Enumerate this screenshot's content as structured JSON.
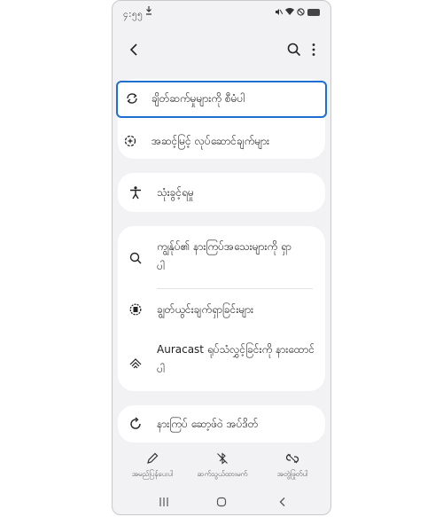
{
  "status_bar": {
    "time": "၄:၅၅",
    "icons": [
      "download-icon",
      "mute-icon",
      "wifi-icon",
      "block-icon",
      "battery-icon"
    ]
  },
  "app_bar": {
    "icons": [
      "back-icon",
      "search-icon",
      "more-options-icon"
    ]
  },
  "menu": {
    "highlighted": "ချိတ်ဆက်မှုများကို စီမံပါ",
    "group1": [
      {
        "label": "အဆင့်မြင့် လုပ်ဆောင်ချက်များ",
        "icon": "gear-plus-icon"
      }
    ],
    "group2": [
      {
        "label": "သုံးခွင့်ရမှု",
        "icon": "accessibility-icon"
      }
    ],
    "group3": [
      {
        "label": "ကျွန်ုပ်၏ နားကြပ်အသေးများကို ရှာ",
        "label2": "ပါ",
        "icon": "search-icon"
      },
      {
        "label": "ချွတ်ယွင်းချက်ရှာခြင်းများ",
        "icon": "diagnostics-icon"
      },
      {
        "label": "Auracast ရုပ်သံလွှင့်ခြင်းကို နားထောင်",
        "label2": "ပါ",
        "icon": "broadcast-icon"
      }
    ],
    "group4": [
      {
        "label": "နားကြပ် ဆော့ဖ်ဝဲ အပ်ဒိတ်",
        "icon": "update-icon"
      }
    ]
  },
  "bottom_bar": [
    {
      "label": "အမည်ပြန်ပေးပါ",
      "icon": "pencil-icon"
    },
    {
      "label": "ဆက်သွယ်ထားမက်",
      "icon": "bluetooth-off-icon"
    },
    {
      "label": "အတွဲဖြုတ်ပါ",
      "icon": "unlink-icon"
    }
  ],
  "nav_bar": {
    "icons": [
      "recents-icon",
      "home-icon",
      "back-nav-icon"
    ]
  },
  "colors": {
    "highlight": "#1e6fd0",
    "background": "#f2f2f4",
    "card": "#ffffff"
  }
}
